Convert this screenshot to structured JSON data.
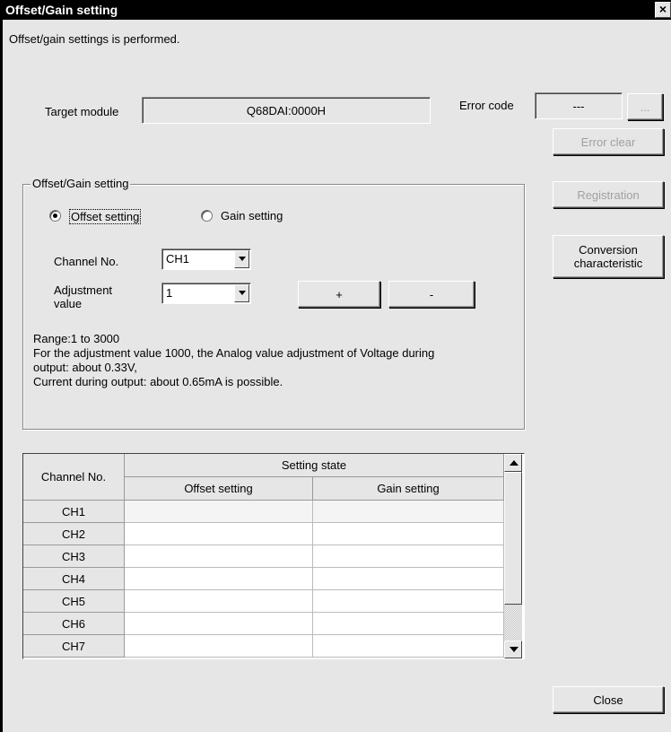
{
  "window": {
    "title": "Offset/Gain setting",
    "close_glyph": "×"
  },
  "intro_text": "Offset/gain settings is performed.",
  "target_module": {
    "label": "Target module",
    "value": "Q68DAI:0000H"
  },
  "error_code": {
    "label": "Error code",
    "value": "---",
    "browse_label": "..."
  },
  "buttons": {
    "error_clear": "Error clear",
    "registration": "Registration",
    "conversion_line1": "Conversion",
    "conversion_line2": "characteristic",
    "close": "Close"
  },
  "group": {
    "title": "Offset/Gain setting",
    "offset_radio": "Offset setting",
    "gain_radio": "Gain setting",
    "selected": "offset",
    "channel_label": "Channel No.",
    "channel_value": "CH1",
    "adjust_label_line1": "Adjustment",
    "adjust_label_line2": "value",
    "adjust_value": "1",
    "plus_label": "+",
    "minus_label": "-",
    "range_line1": "Range:1 to 3000",
    "range_line2": "For the adjustment value 1000, the Analog value adjustment of Voltage during",
    "range_line3": "output: about 0.33V,",
    "range_line4": "Current during output: about 0.65mA is possible."
  },
  "table": {
    "col_channel": "Channel No.",
    "col_setting_state": "Setting state",
    "col_offset": "Offset setting",
    "col_gain": "Gain setting",
    "rows": [
      {
        "ch": "CH1",
        "offset": "",
        "gain": ""
      },
      {
        "ch": "CH2",
        "offset": "",
        "gain": ""
      },
      {
        "ch": "CH3",
        "offset": "",
        "gain": ""
      },
      {
        "ch": "CH4",
        "offset": "",
        "gain": ""
      },
      {
        "ch": "CH5",
        "offset": "",
        "gain": ""
      },
      {
        "ch": "CH6",
        "offset": "",
        "gain": ""
      },
      {
        "ch": "CH7",
        "offset": "",
        "gain": ""
      }
    ]
  },
  "colors": {
    "face": "#e6e6e6",
    "titlebar": "#000000",
    "disabled_text": "#a0a0a0"
  },
  "icons": {
    "up_arrow": "scroll-up-arrow",
    "down_arrow": "scroll-down-arrow",
    "dropdown": "chevron-down"
  }
}
